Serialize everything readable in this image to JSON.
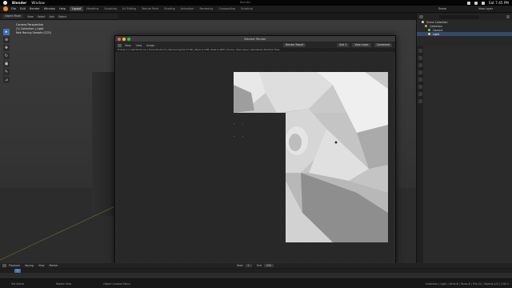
{
  "macos": {
    "app_name": "Blender",
    "menu": [
      "Window"
    ],
    "window_title": "Blender",
    "clock": "Sat 7:45 PM"
  },
  "topbar": {
    "menus": [
      "File",
      "Edit",
      "Render",
      "Window",
      "Help"
    ],
    "workspaces": [
      "Layout",
      "Modeling",
      "Sculpting",
      "UV Editing",
      "Texture Paint",
      "Shading",
      "Animation",
      "Rendering",
      "Compositing",
      "Scripting"
    ],
    "active_workspace": "Layout",
    "scene_label": "Scene",
    "view_layer_label": "View Layer"
  },
  "viewport": {
    "mode": "Object Mode",
    "menus": [
      "View",
      "Select",
      "Add",
      "Object"
    ],
    "info_lines": [
      "Camera Perspective",
      "(1) Collection | Light",
      "Noir Racing Sample (CC0)"
    ]
  },
  "outliner": {
    "title": "Scene Collection",
    "items": [
      {
        "label": "Scene Collection",
        "color": "#cfcfcf"
      },
      {
        "label": "Collection",
        "color": "#e0a040"
      },
      {
        "label": "Camera",
        "color": "#7cc26e"
      },
      {
        "label": "Light",
        "color": "#e8d35a"
      }
    ],
    "selected_index": 3
  },
  "render_window": {
    "title": "Blender Render",
    "menus": [
      "View",
      "View",
      "Image"
    ],
    "slot_name": "Render Result",
    "slot": "Slot 1",
    "layer": "View Layer",
    "pass": "Combined",
    "status_text": "Frame:1 | Last:00:01.12 | Time:00:29.70 | Remaining:00:27.88 | Mem:2.13M, Peak:2.46M | Scene, View Layer | Rendered 201/512 Tiles"
  },
  "timeline": {
    "menus": [
      "Playback",
      "Keying",
      "View",
      "Marker"
    ],
    "start_label": "Start",
    "start": "1",
    "end_label": "End",
    "end": "250",
    "current_frame": "1"
  },
  "statusbar": {
    "left": [
      "Set Active",
      "Rotate View",
      "Object Context Menu"
    ],
    "right": "Collection | Light | Verts:8 | Faces:6 | Tris:12 | Objects:1/3 | 2.90.1"
  },
  "colors": {
    "accent": "#4772b3",
    "blender_orange": "#e88a2a",
    "traffic_red": "#ff5f57",
    "traffic_yellow": "#febc2e",
    "traffic_green": "#28c840"
  }
}
